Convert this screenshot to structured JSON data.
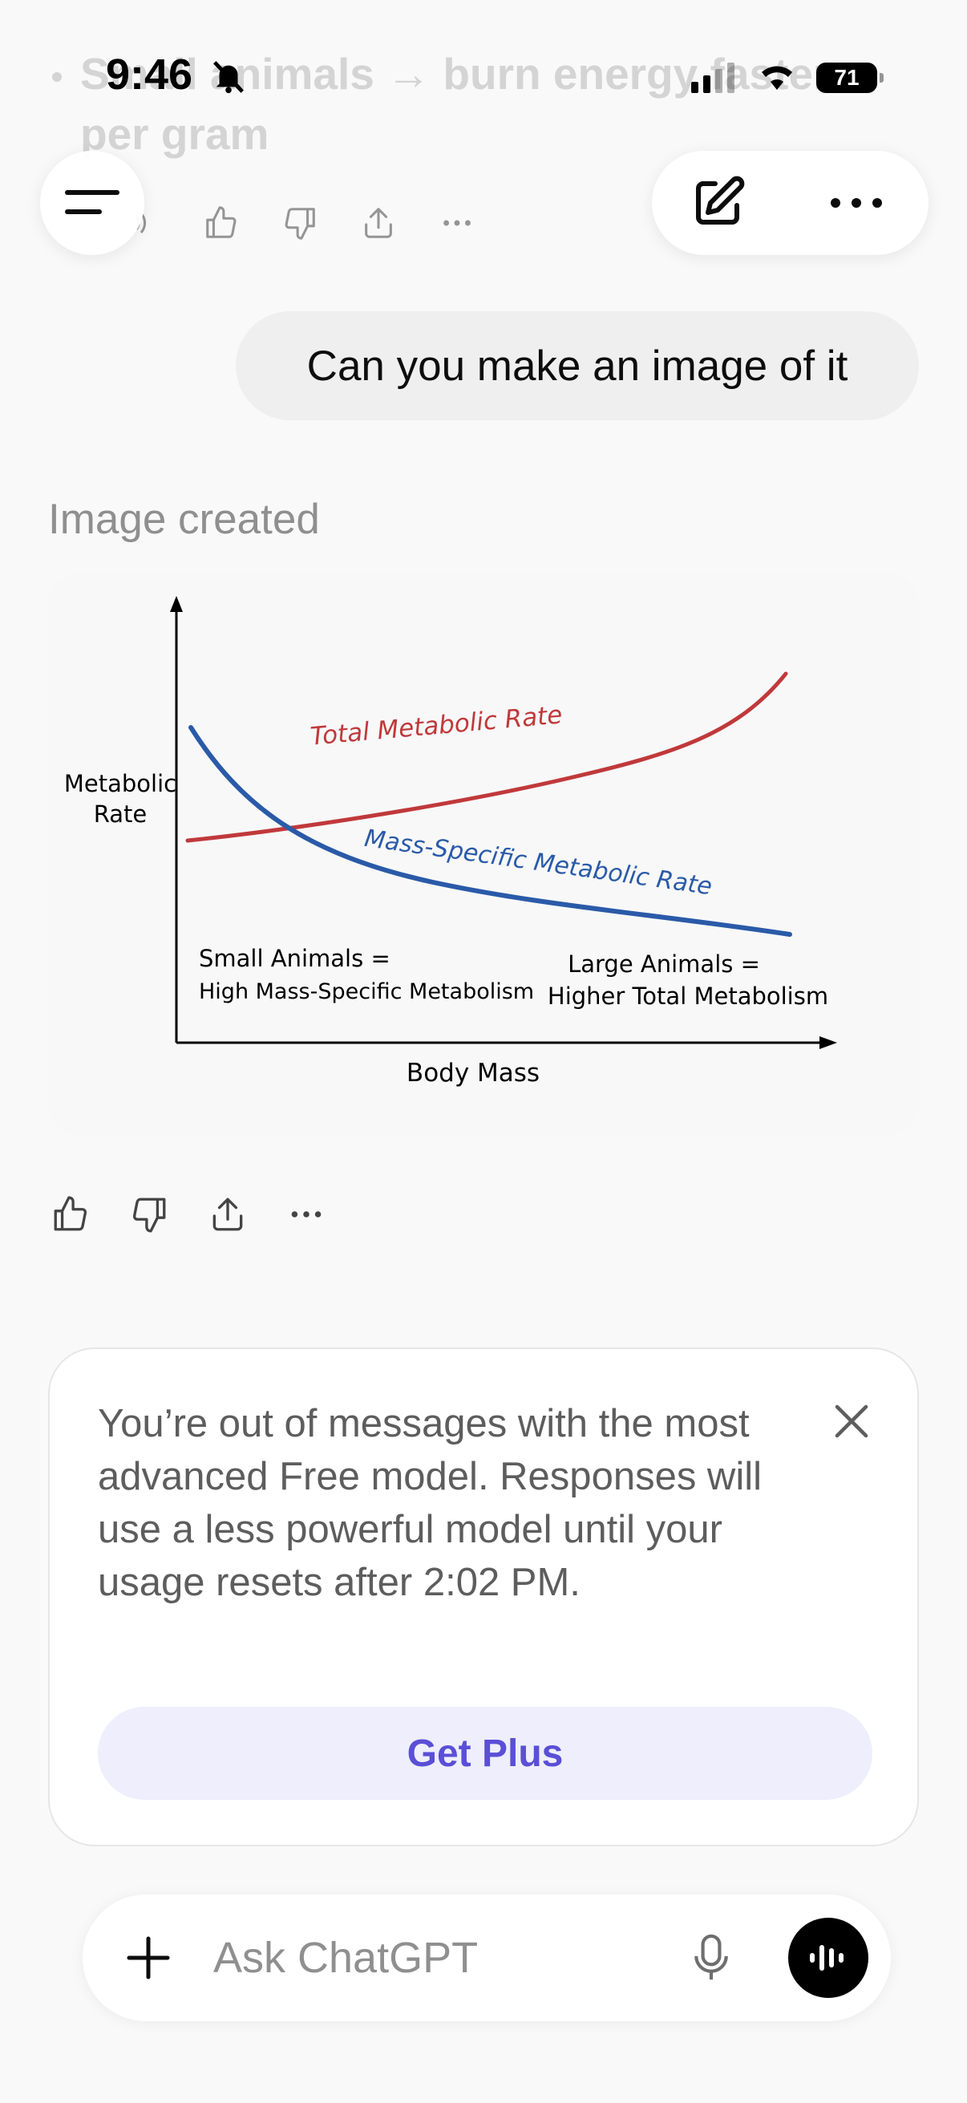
{
  "status_bar": {
    "time": "9:46",
    "battery": "71"
  },
  "previous_message": {
    "line1": "Small animals → burn energy faster",
    "line2": "per gram"
  },
  "user_message": "Can you make an image of it",
  "assistant": {
    "status_label": "Image created",
    "image": {
      "y_label_line1": "Metabolic",
      "y_label_line2": "Rate",
      "x_label": "Body Mass",
      "curve_total_label": "Total Metabolic Rate",
      "curve_mass_specific_label": "Mass-Specific Metabolic Rate",
      "small_note_line1": "Small Animals =",
      "small_note_line2": "High Mass-Specific Metabolism",
      "large_note_line1": "Large Animals =",
      "large_note_line2": "Higher Total Metabolism",
      "colors": {
        "total": "#c0393b",
        "mass_specific": "#2a5aa8",
        "axis": "#000000"
      }
    }
  },
  "limit_notice": {
    "message": "You’re out of messages with the most advanced Free model. Responses will use a less powerful model until your usage resets after 2:02 PM.",
    "cta_label": "Get Plus"
  },
  "composer": {
    "placeholder": "Ask ChatGPT"
  },
  "colors": {
    "accent": "#5a4fd6",
    "accent_bg": "#eeeefc",
    "bubble_bg": "#efefef"
  }
}
